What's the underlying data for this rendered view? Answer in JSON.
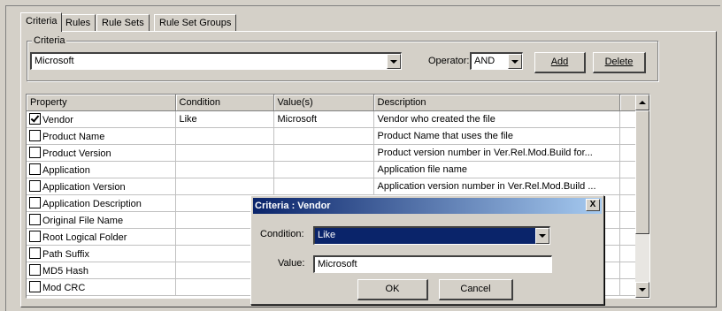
{
  "tabs": [
    {
      "label": "Criteria"
    },
    {
      "label": "Rules"
    },
    {
      "label": "Rule Sets"
    },
    {
      "label": "Rule Set Groups"
    }
  ],
  "criteria_group": {
    "label": "Criteria",
    "selected": "Microsoft",
    "operator_label": "Operator:",
    "operator_value": "AND",
    "add_button": "Add",
    "delete_button": "Delete"
  },
  "grid": {
    "columns": [
      "Property",
      "Condition",
      "Value(s)",
      "Description"
    ],
    "rows": [
      {
        "checked": true,
        "property": "Vendor",
        "condition": "Like",
        "value": "Microsoft",
        "description": "Vendor who created the file"
      },
      {
        "checked": false,
        "property": "Product Name",
        "condition": "",
        "value": "",
        "description": "Product Name that uses the file"
      },
      {
        "checked": false,
        "property": "Product Version",
        "condition": "",
        "value": "",
        "description": "Product version number in Ver.Rel.Mod.Build for..."
      },
      {
        "checked": false,
        "property": "Application",
        "condition": "",
        "value": "",
        "description": "Application file name"
      },
      {
        "checked": false,
        "property": "Application Version",
        "condition": "",
        "value": "",
        "description": "Application version number in Ver.Rel.Mod.Build ..."
      },
      {
        "checked": false,
        "property": "Application Description",
        "condition": "",
        "value": "",
        "description": ""
      },
      {
        "checked": false,
        "property": "Original File Name",
        "condition": "",
        "value": "",
        "description": ""
      },
      {
        "checked": false,
        "property": "Root Logical Folder",
        "condition": "",
        "value": "",
        "description": "..."
      },
      {
        "checked": false,
        "property": "Path Suffix",
        "condition": "",
        "value": "",
        "description": "..."
      },
      {
        "checked": false,
        "property": "MD5 Hash",
        "condition": "",
        "value": "",
        "description": ""
      },
      {
        "checked": false,
        "property": "Mod CRC",
        "condition": "",
        "value": "",
        "description": ""
      }
    ]
  },
  "dialog": {
    "title": "Criteria : Vendor",
    "close": "X",
    "condition_label": "Condition:",
    "condition_value": "Like",
    "value_label": "Value:",
    "value_value": "Microsoft",
    "ok": "OK",
    "cancel": "Cancel"
  }
}
